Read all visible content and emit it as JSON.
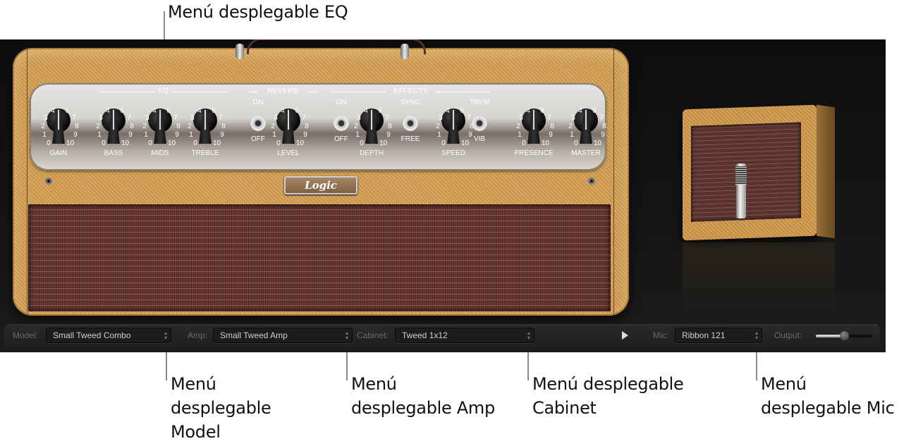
{
  "callouts": {
    "eq": "Menú desplegable EQ",
    "model": "Menú\ndesplegable\nModel",
    "amp": "Menú\ndesplegable Amp",
    "cabinet": "Menú desplegable\nCabinet",
    "mic": "Menú\ndesplegable Mic"
  },
  "amp_panel": {
    "sections": {
      "eq": "EQ",
      "reverb": "REVERB",
      "effects": "EFFECTS"
    },
    "knob_scale": [
      "0",
      "1",
      "2",
      "3",
      "4",
      "5",
      "6",
      "7",
      "8",
      "9",
      "10"
    ],
    "knobs": [
      {
        "id": "gain",
        "label": "GAIN",
        "value": 5
      },
      {
        "id": "bass",
        "label": "BASS",
        "value": 5
      },
      {
        "id": "mids",
        "label": "MIDS",
        "value": 5
      },
      {
        "id": "treble",
        "label": "TREBLE",
        "value": 5
      },
      {
        "id": "level",
        "label": "LEVEL",
        "value": 5
      },
      {
        "id": "depth",
        "label": "DEPTH",
        "value": 5
      },
      {
        "id": "speed",
        "label": "SPEED",
        "value": 5
      },
      {
        "id": "presence",
        "label": "PRESENCE",
        "value": 5
      },
      {
        "id": "master",
        "label": "MASTER",
        "value": 5
      }
    ],
    "switches": {
      "reverb": {
        "top": "ON",
        "bottom": "OFF",
        "state": "OFF"
      },
      "effects": {
        "top": "ON",
        "bottom": "OFF",
        "state": "OFF"
      },
      "sync": {
        "top": "SYNC",
        "bottom": "FREE",
        "state": "FREE"
      },
      "mode": {
        "top": "TREM",
        "bottom": "VIB",
        "state": "TREM"
      }
    },
    "logo": "Logic"
  },
  "bottom_bar": {
    "model": {
      "label": "Model:",
      "value": "Small Tweed Combo"
    },
    "amp": {
      "label": "Amp:",
      "value": "Small Tweed Amp"
    },
    "cabinet": {
      "label": "Cabinet:",
      "value": "Tweed 1x12"
    },
    "mic": {
      "label": "Mic:",
      "value": "Ribbon 121"
    },
    "output": {
      "label": "Output:",
      "value_fraction": 0.5
    },
    "arrows": "▴\n▾"
  }
}
